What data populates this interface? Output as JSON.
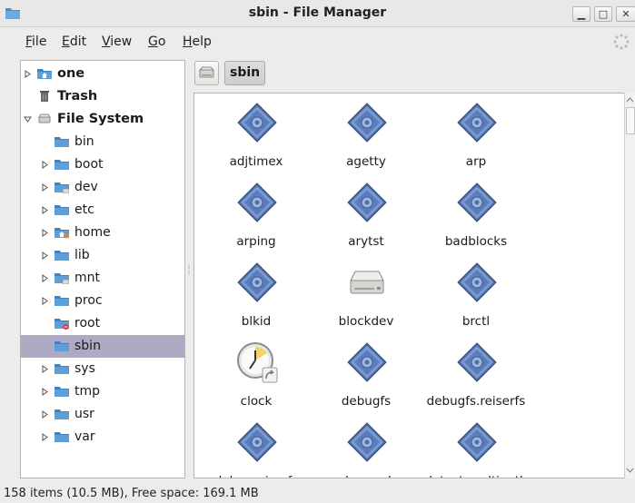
{
  "window": {
    "title": "sbin - File Manager"
  },
  "menu": [
    {
      "label": "File",
      "u": "F",
      "rest": "ile"
    },
    {
      "label": "Edit",
      "u": "E",
      "rest": "dit"
    },
    {
      "label": "View",
      "u": "V",
      "rest": "iew"
    },
    {
      "label": "Go",
      "u": "G",
      "rest": "o"
    },
    {
      "label": "Help",
      "u": "H",
      "rest": "elp"
    }
  ],
  "sidebar": {
    "items": [
      {
        "label": "one",
        "icon": "home-folder-icon",
        "bold": true,
        "expander": "collapsed",
        "indent": 0
      },
      {
        "label": "Trash",
        "icon": "trash-icon",
        "bold": true,
        "expander": "none",
        "indent": 0
      },
      {
        "label": "File System",
        "icon": "drive-icon",
        "bold": true,
        "expander": "expanded",
        "indent": 0
      },
      {
        "label": "bin",
        "icon": "folder-icon",
        "expander": "none",
        "indent": 1
      },
      {
        "label": "boot",
        "icon": "folder-icon",
        "expander": "collapsed",
        "indent": 1
      },
      {
        "label": "dev",
        "icon": "folder-dev-icon",
        "expander": "collapsed",
        "indent": 1
      },
      {
        "label": "etc",
        "icon": "folder-icon",
        "expander": "collapsed",
        "indent": 1
      },
      {
        "label": "home",
        "icon": "folder-home-icon",
        "expander": "collapsed",
        "indent": 1
      },
      {
        "label": "lib",
        "icon": "folder-icon",
        "expander": "collapsed",
        "indent": 1
      },
      {
        "label": "mnt",
        "icon": "folder-dev-icon",
        "expander": "collapsed",
        "indent": 1
      },
      {
        "label": "proc",
        "icon": "folder-icon",
        "expander": "collapsed",
        "indent": 1
      },
      {
        "label": "root",
        "icon": "folder-locked-icon",
        "expander": "none",
        "indent": 1
      },
      {
        "label": "sbin",
        "icon": "folder-icon",
        "expander": "none",
        "indent": 1,
        "selected": true
      },
      {
        "label": "sys",
        "icon": "folder-icon",
        "expander": "collapsed",
        "indent": 1
      },
      {
        "label": "tmp",
        "icon": "folder-icon",
        "expander": "collapsed",
        "indent": 1
      },
      {
        "label": "usr",
        "icon": "folder-icon",
        "expander": "collapsed",
        "indent": 1
      },
      {
        "label": "var",
        "icon": "folder-icon",
        "expander": "collapsed",
        "indent": 1
      }
    ]
  },
  "pathbar": {
    "current": "sbin"
  },
  "files": [
    {
      "name": "adjtimex",
      "icon": "executable-icon"
    },
    {
      "name": "agetty",
      "icon": "executable-icon"
    },
    {
      "name": "arp",
      "icon": "executable-icon"
    },
    {
      "name": "arping",
      "icon": "executable-icon"
    },
    {
      "name": "arytst",
      "icon": "executable-icon"
    },
    {
      "name": "badblocks",
      "icon": "executable-icon"
    },
    {
      "name": "blkid",
      "icon": "executable-icon"
    },
    {
      "name": "blockdev",
      "icon": "drive-icon"
    },
    {
      "name": "brctl",
      "icon": "executable-icon"
    },
    {
      "name": "clock",
      "icon": "clock-link-icon"
    },
    {
      "name": "debugfs",
      "icon": "executable-icon"
    },
    {
      "name": "debugfs.reiserfs",
      "icon": "executable-icon"
    },
    {
      "name": "debugreiserfs",
      "icon": "executable-icon"
    },
    {
      "name": "depmod",
      "icon": "executable-icon"
    },
    {
      "name": "detect-multipath",
      "icon": "executable-icon"
    }
  ],
  "status": {
    "text": "158 items (10.5 MB), Free space: 169.1 MB"
  },
  "colors": {
    "selection": "#b0a9c3",
    "folder": "#4a8fc9",
    "executable": "#5b7fb6"
  }
}
